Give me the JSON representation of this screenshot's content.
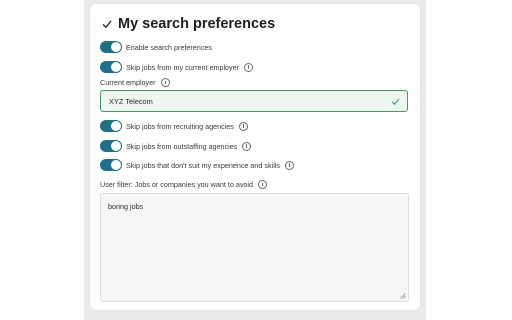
{
  "title": "My search preferences",
  "toggles": {
    "enable": "Enable search preferences",
    "skip_current": "Skip jobs from my current employer",
    "skip_recruiting": "Skip jobs from recruiting agencies",
    "skip_outstaffing": "Skip jobs from outstaffing agencies",
    "skip_unsuitable": "Skip jobs that don't suit my experience and skills"
  },
  "current_employer": {
    "label": "Current employer",
    "value": "XYZ Telecom"
  },
  "user_filter": {
    "label": "User filter: Jobs or companies you want to avoid",
    "value": "boring jobs"
  },
  "colors": {
    "toggle_on": "#1f6f86",
    "valid_border": "#3f9a66",
    "valid_bg": "#eef7ef"
  }
}
